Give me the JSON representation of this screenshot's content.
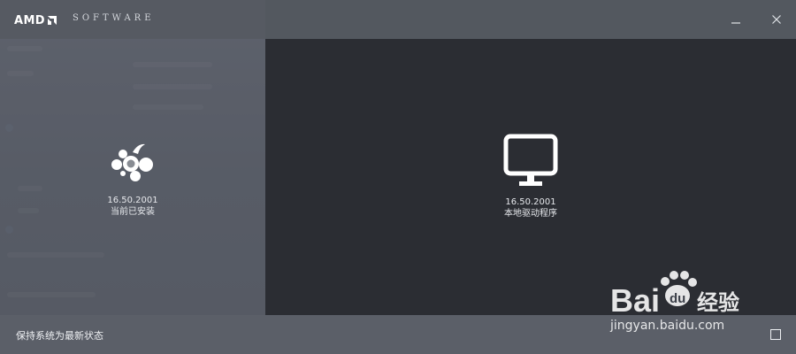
{
  "window": {
    "brand": "AMD",
    "product": "SOFTWARE",
    "minimize_icon": "minimize-icon",
    "close_icon": "close-icon"
  },
  "panels": {
    "installed": {
      "version": "16.50.2001",
      "label": "当前已安装",
      "icon": "amd-radeon-logo-icon"
    },
    "local": {
      "version": "16.50.2001",
      "label": "本地驱动程序",
      "icon": "monitor-icon"
    }
  },
  "footer": {
    "keep_updated_label": "保持系统为最新状态",
    "checkbox_checked": false
  },
  "watermark": {
    "brand_left": "Bai",
    "brand_right": "du",
    "tail": "经验",
    "url": "jingyan.baidu.com"
  },
  "colors": {
    "titlebar": "#565a62",
    "right_pane": "#2b2d33",
    "footer": "#5b5f68",
    "text": "#e9ebee"
  }
}
